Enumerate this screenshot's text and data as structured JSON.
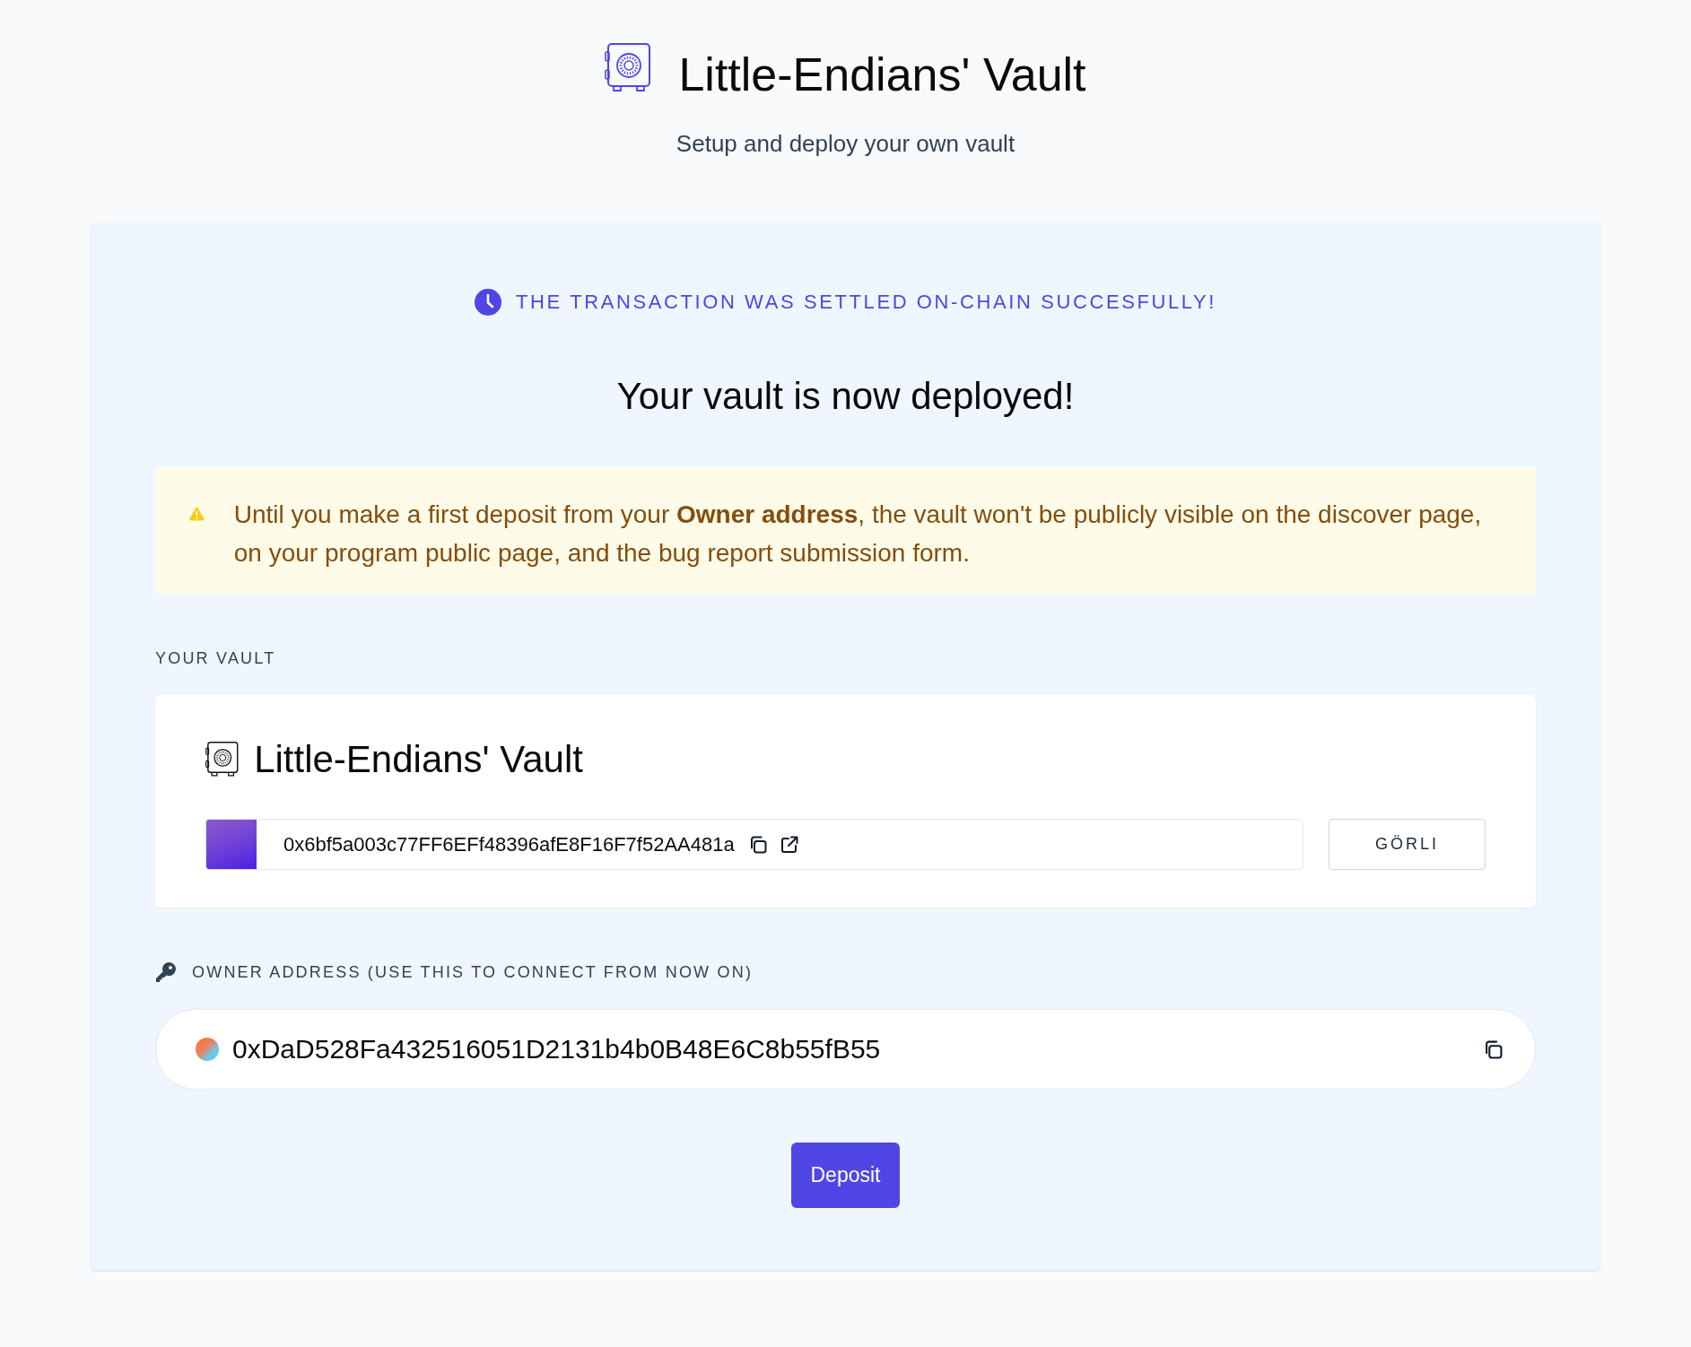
{
  "header": {
    "title": "Little-Endians' Vault",
    "subtitle": "Setup and deploy your own vault"
  },
  "status_banner": {
    "text": "THE TRANSACTION WAS SETTLED ON-CHAIN SUCCESFULLY!"
  },
  "heading": "Your vault is now deployed!",
  "warning": {
    "text": "Until you make a first deposit from your **Owner address**, the vault won't be publicly visible on the discover page, on your program public page, and the bug report submission form."
  },
  "vault_section": {
    "label": "YOUR VAULT",
    "vault": {
      "name": "Little-Endians' Vault",
      "address": "0x6bf5a003c77FF6EFf48396afE8F16F7f52AA481a",
      "network": "GÖRLI"
    }
  },
  "owner_section": {
    "label": "OWNER ADDRESS (USE THIS TO CONNECT FROM NOW ON)",
    "address": "0xDaD528Fa432516051D2131b4b0B48E6C8b55fB55"
  },
  "deposit_button": "Deposit"
}
